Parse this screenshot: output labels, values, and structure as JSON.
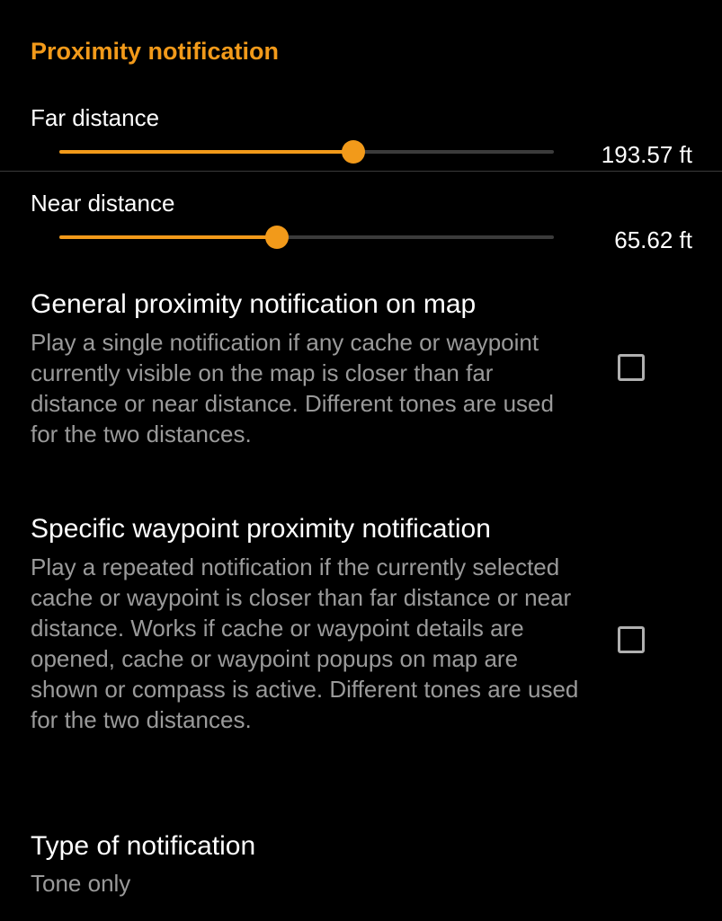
{
  "section": {
    "header": "Proximity notification"
  },
  "far_distance": {
    "title": "Far distance",
    "value_label": "193.57 ft",
    "slider_fraction": 0.594
  },
  "near_distance": {
    "title": "Near distance",
    "value_label": "65.62 ft",
    "slider_fraction": 0.44
  },
  "general_proximity": {
    "title": "General proximity notification on map",
    "summary": "Play a single notification if any cache or waypoint currently visible on the map is closer than far distance or near distance. Different tones are used for the two distances.",
    "checked": false
  },
  "specific_waypoint": {
    "title": "Specific waypoint proximity notification",
    "summary": "Play a repeated notification if the currently selected cache or waypoint is closer than far distance or near distance. Works if cache or waypoint details are opened, cache or waypoint popups on map are shown or compass is active. Different tones are used for the two distances.",
    "checked": false
  },
  "notification_type": {
    "title": "Type of notification",
    "value": "Tone only"
  },
  "colors": {
    "accent": "#f29a1a",
    "background": "#000000",
    "summary_text": "#9a9a9a"
  }
}
